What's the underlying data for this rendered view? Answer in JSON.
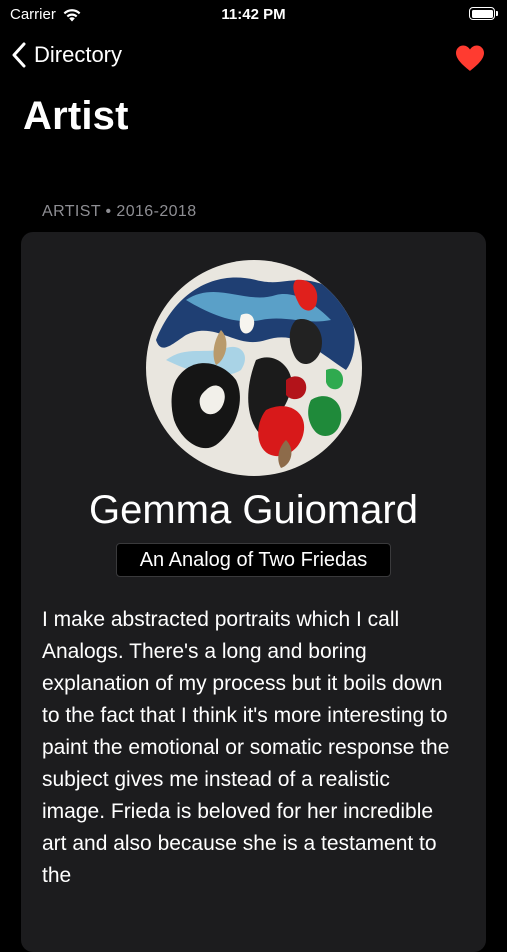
{
  "status_bar": {
    "carrier": "Carrier",
    "time": "11:42 PM",
    "wifi_icon": "wifi-icon",
    "battery_icon": "battery-icon"
  },
  "nav": {
    "back_label": "Directory",
    "back_icon": "chevron-left-icon",
    "favorite_icon": "heart-icon",
    "favorite_color": "#ff3b30",
    "title": "Artist"
  },
  "section": {
    "header": "ARTIST • 2016-2018"
  },
  "artist": {
    "name": "Gemma Guiomard",
    "work_title": "An Analog of Two Friedas",
    "bio": "I make abstracted portraits which I call Analogs. There's a long and boring explanation of my process but it boils down to the fact that I think it's more interesting to paint the emotional or somatic response the subject gives me instead of a realistic image. Frieda is beloved for her incredible art and also because she is a testament to the"
  },
  "colors": {
    "background": "#000000",
    "card": "#1c1c1e",
    "secondary_text": "#8e8e93"
  }
}
